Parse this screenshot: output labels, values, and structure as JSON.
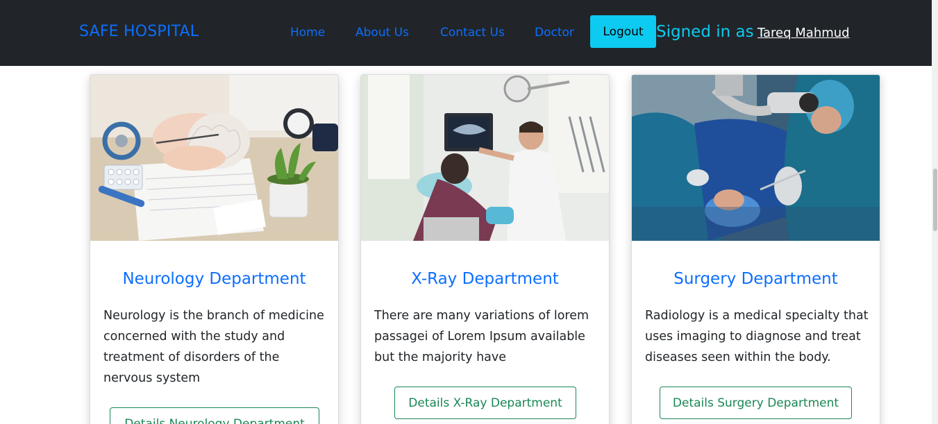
{
  "nav": {
    "brand": "SAFE HOSPITAL",
    "links": [
      "Home",
      "About Us",
      "Contact Us",
      "Doctor"
    ],
    "logout": "Logout",
    "signed_in_label": "Signed in as :",
    "user_name": "Tareq Mahmud"
  },
  "colors": {
    "navbar_bg": "#212529",
    "primary": "#0d6efd",
    "info": "#0dcaf0",
    "success": "#198754"
  },
  "cards": [
    {
      "title": "Neurology Department",
      "text": "Neurology is the branch of medicine concerned with the study and treatment of disorders of the nervous system",
      "button": "Details Neurology Department",
      "image_icon": "neurology-brain-photo"
    },
    {
      "title": "X-Ray Department",
      "text": "There are many variations of lorem passagei of Lorem Ipsum available but the majority have",
      "button": "Details X-Ray Department",
      "image_icon": "xray-dentist-photo"
    },
    {
      "title": "Surgery Department",
      "text": "Radiology is a medical specialty that uses imaging to diagnose and treat diseases seen within the body.",
      "button": "Details Surgery Department",
      "image_icon": "surgery-room-photo"
    }
  ]
}
